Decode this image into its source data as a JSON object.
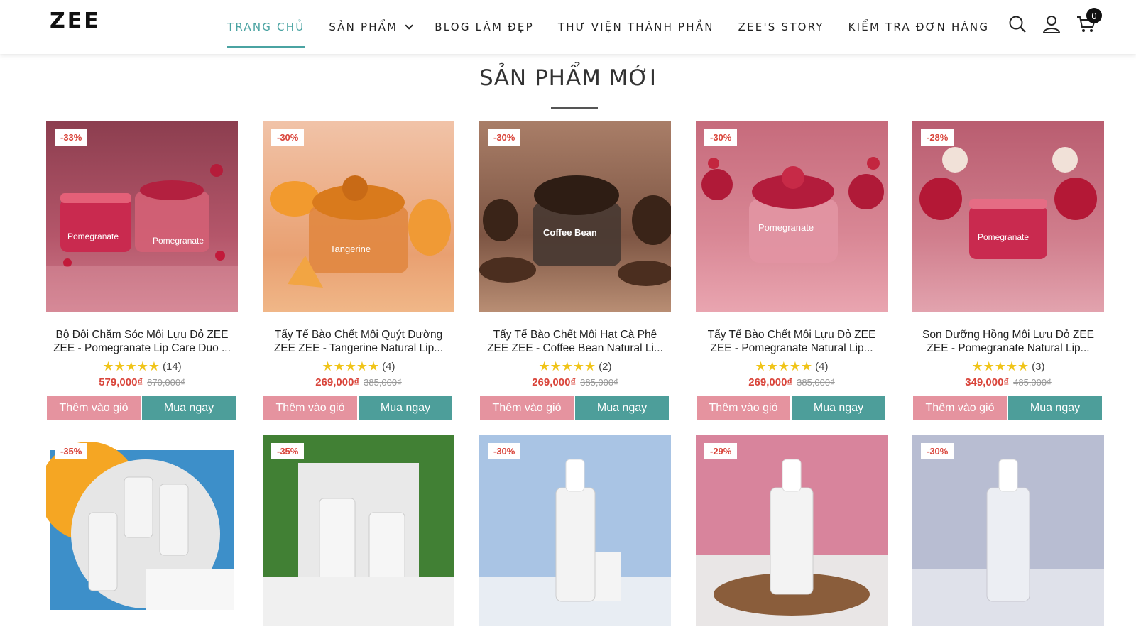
{
  "header": {
    "logo": "ZEE",
    "nav": [
      {
        "label": "TRANG CHỦ",
        "active": true
      },
      {
        "label": "SẢN PHẨM",
        "dropdown": true
      },
      {
        "label": "BLOG LÀM ĐẸP"
      },
      {
        "label": "THƯ VIỆN THÀNH PHẦN"
      },
      {
        "label": "ZEE'S STORY"
      },
      {
        "label": "KIỂM TRA ĐƠN HÀNG"
      }
    ],
    "icons": [
      "search-icon",
      "user-icon",
      "cart-icon"
    ],
    "cart_count": "0"
  },
  "section": {
    "title": "SẢN PHẨM MỚI"
  },
  "buttons": {
    "add_to_cart": "Thêm vào giỏ",
    "buy_now": "Mua ngay"
  },
  "products_row1": [
    {
      "discount": "-33%",
      "name_line1": "Bộ Đôi Chăm Sóc Môi Lựu Đỏ ZEE",
      "name_line2": "ZEE - Pomegranate Lip Care Duo ...",
      "rating_count": "(14)",
      "price": "579,000₫",
      "old_price": "870,000₫",
      "label": "Pomegranate",
      "theme": "pom"
    },
    {
      "discount": "-30%",
      "name_line1": "Tẩy Tế Bào Chết Môi Quýt Đường",
      "name_line2": "ZEE ZEE - Tangerine Natural Lip...",
      "rating_count": "(4)",
      "price": "269,000₫",
      "old_price": "385,000₫",
      "label": "Tangerine",
      "theme": "tang"
    },
    {
      "discount": "-30%",
      "name_line1": "Tẩy Tế Bào Chết Môi Hạt Cà Phê",
      "name_line2": "ZEE ZEE - Coffee Bean Natural Li...",
      "rating_count": "(2)",
      "price": "269,000₫",
      "old_price": "385,000₫",
      "label": "Coffee Bean",
      "theme": "coffee"
    },
    {
      "discount": "-30%",
      "name_line1": "Tẩy Tế Bào Chết Môi Lựu Đỏ ZEE",
      "name_line2": "ZEE - Pomegranate Natural Lip...",
      "rating_count": "(4)",
      "price": "269,000₫",
      "old_price": "385,000₫",
      "label": "Pomegranate",
      "theme": "pom2"
    },
    {
      "discount": "-28%",
      "name_line1": "Son Dưỡng Hồng Môi Lựu Đỏ ZEE",
      "name_line2": "ZEE - Pomegranate Natural Lip...",
      "rating_count": "(3)",
      "price": "349,000₫",
      "old_price": "485,000₫",
      "label": "Pomegranate",
      "theme": "pom3"
    }
  ],
  "products_row2": [
    {
      "discount": "-35%",
      "theme": "beach"
    },
    {
      "discount": "-35%",
      "theme": "leaf"
    },
    {
      "discount": "-30%",
      "theme": "blue"
    },
    {
      "discount": "-29%",
      "theme": "pink"
    },
    {
      "discount": "-30%",
      "theme": "grey"
    }
  ],
  "colors": {
    "accent_teal": "#4aa3a2",
    "add_cart_pink": "#e5939f",
    "buy_teal": "#4d9e9a",
    "sale_red": "#d9453b",
    "star_yellow": "#f0c419"
  }
}
